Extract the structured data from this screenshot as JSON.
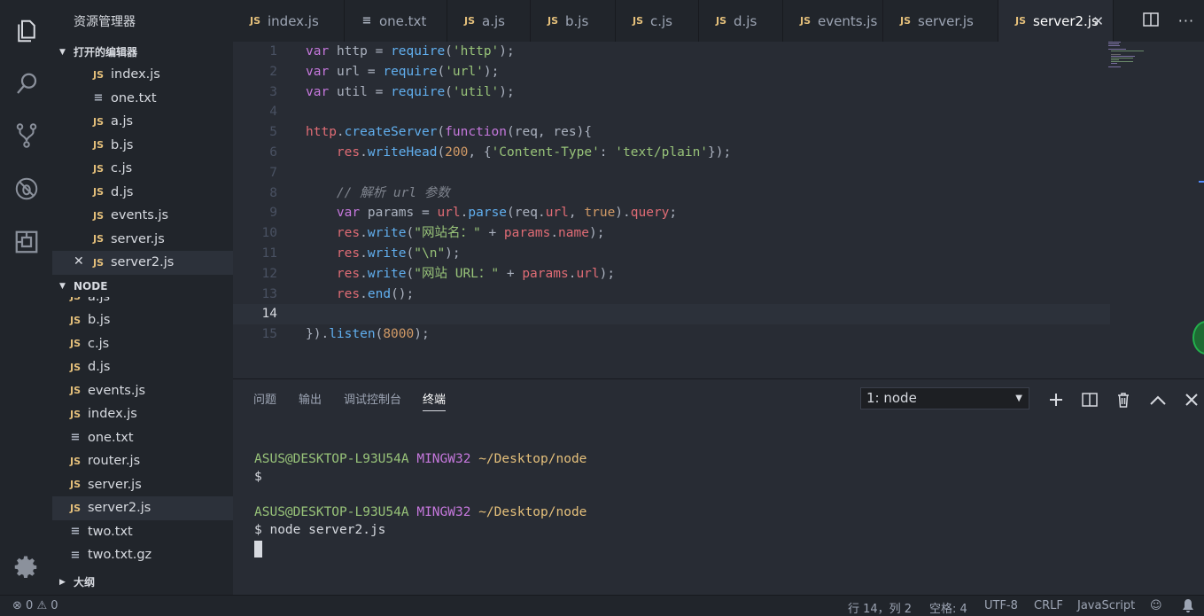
{
  "sidebar": {
    "title": "资源管理器",
    "open_editors_label": "打开的编辑器",
    "open_editors": [
      {
        "name": "index.js",
        "type": "js"
      },
      {
        "name": "one.txt",
        "type": "txt"
      },
      {
        "name": "a.js",
        "type": "js"
      },
      {
        "name": "b.js",
        "type": "js"
      },
      {
        "name": "c.js",
        "type": "js"
      },
      {
        "name": "d.js",
        "type": "js"
      },
      {
        "name": "events.js",
        "type": "js"
      },
      {
        "name": "server.js",
        "type": "js"
      },
      {
        "name": "server2.js",
        "type": "js"
      }
    ],
    "node_label": "NODE",
    "node_files": [
      {
        "name": "a.js",
        "type": "js"
      },
      {
        "name": "b.js",
        "type": "js"
      },
      {
        "name": "c.js",
        "type": "js"
      },
      {
        "name": "d.js",
        "type": "js"
      },
      {
        "name": "events.js",
        "type": "js"
      },
      {
        "name": "index.js",
        "type": "js"
      },
      {
        "name": "one.txt",
        "type": "txt"
      },
      {
        "name": "router.js",
        "type": "js"
      },
      {
        "name": "server.js",
        "type": "js"
      },
      {
        "name": "server2.js",
        "type": "js"
      },
      {
        "name": "two.txt",
        "type": "txt"
      },
      {
        "name": "two.txt.gz",
        "type": "txt"
      }
    ],
    "outline_label": "大纲",
    "js_badge": "JS",
    "txt_badge": "≡",
    "close_glyph": "✕"
  },
  "tabs": [
    {
      "name": "index.js",
      "type": "js"
    },
    {
      "name": "one.txt",
      "type": "txt"
    },
    {
      "name": "a.js",
      "type": "js"
    },
    {
      "name": "b.js",
      "type": "js"
    },
    {
      "name": "c.js",
      "type": "js"
    },
    {
      "name": "d.js",
      "type": "js"
    },
    {
      "name": "events.js",
      "type": "js"
    },
    {
      "name": "server.js",
      "type": "js"
    },
    {
      "name": "server2.js",
      "type": "js",
      "active": true
    }
  ],
  "editor": {
    "line_numbers": [
      "1",
      "2",
      "3",
      "4",
      "5",
      "6",
      "7",
      "8",
      "9",
      "10",
      "11",
      "12",
      "13",
      "14",
      "15"
    ],
    "current_line": 14
  },
  "panel": {
    "tabs": [
      "问题",
      "输出",
      "调试控制台",
      "终端"
    ],
    "active_tab": "终端",
    "terminal_select": "1: node",
    "prompt_user": "ASUS@DESKTOP-L93U54A",
    "prompt_env": "MINGW32",
    "prompt_path": "~/Desktop/node",
    "prompt_dollar": "$",
    "command": "$ node server2.js"
  },
  "status": {
    "errors": "0",
    "warnings": "0",
    "position": "行 14，列 2",
    "spaces": "空格: 4",
    "encoding": "UTF-8",
    "eol": "CRLF",
    "language": "JavaScript"
  },
  "icons": {
    "activity": [
      "files-icon",
      "search-icon",
      "source-control-icon",
      "debug-icon",
      "extensions-icon",
      "settings-gear-icon"
    ]
  }
}
